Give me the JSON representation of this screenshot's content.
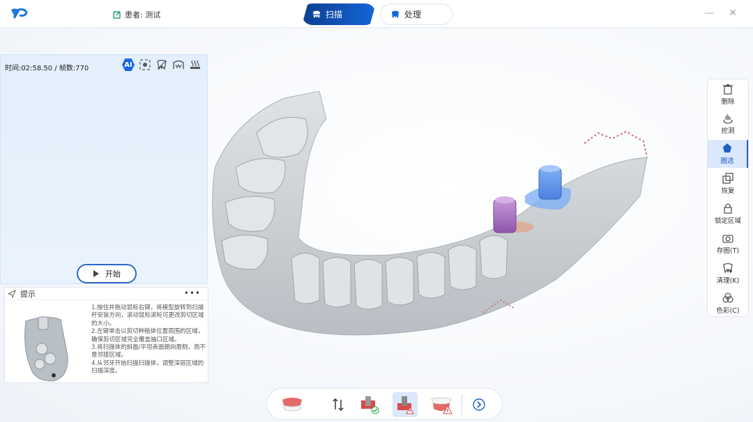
{
  "titlebar": {
    "patient_label": "患者: 测试",
    "tabs": [
      {
        "label": "扫描",
        "active": true
      },
      {
        "label": "处理",
        "active": false
      }
    ],
    "window_buttons": [
      "minimize",
      "close"
    ]
  },
  "left_panel": {
    "time_info": "时间:02:58.50 / 帧数:770",
    "icons": [
      "ai-icon",
      "focus-icon",
      "tooth-mask-icon",
      "arch-icon",
      "heat-icon"
    ],
    "ai_label": "AI",
    "start_label": "开始"
  },
  "tips": {
    "title": "提示",
    "more": "•••",
    "lines": [
      "1.按住并拖动鼠标右键，将模型旋转到扫描杆安装方向，滚动鼠标滚轮可更改剪切区域的大小。",
      "2.左键单击以剪切种植体位置周围的区域，确保剪切区域完全覆盖袖口区域。",
      "3.将扫描体的斜面/平坦表面朝向唇侧，而不是邻接区域。",
      "4.从邻牙开始扫描扫描体，调整深层区域的扫描深度。"
    ]
  },
  "right_toolbar": {
    "items": [
      {
        "label": "删除",
        "icon": "trash-icon",
        "active": false
      },
      {
        "label": "挖洞",
        "icon": "dig-hole-icon",
        "active": false
      },
      {
        "label": "圈选",
        "icon": "lasso-select-icon",
        "active": true
      },
      {
        "label": "恢复",
        "icon": "restore-icon",
        "active": false
      },
      {
        "label": "锁定区域",
        "icon": "lock-icon",
        "active": false
      },
      {
        "label": "存图(T)",
        "icon": "camera-icon",
        "active": false
      },
      {
        "label": "清理(K)",
        "icon": "clean-icon",
        "active": false
      },
      {
        "label": "色彩(C)",
        "icon": "color-icon",
        "active": false
      }
    ]
  },
  "bottom_toolbar": {
    "items": [
      "upper-jaw-icon",
      "swap-jaw-icon",
      "scanbody-checked-icon",
      "scanbody-warning-icon",
      "lower-jaw-warning-icon"
    ],
    "active_index": 3,
    "next_icon": "chevron-right-icon"
  },
  "colors": {
    "brand_blue": "#1565d8",
    "active_bg": "#dbe8fb",
    "model_gray": "#c9ced2",
    "scanbody_purple": "#b27bc7",
    "scanbody_blue": "#5b8fe8"
  }
}
